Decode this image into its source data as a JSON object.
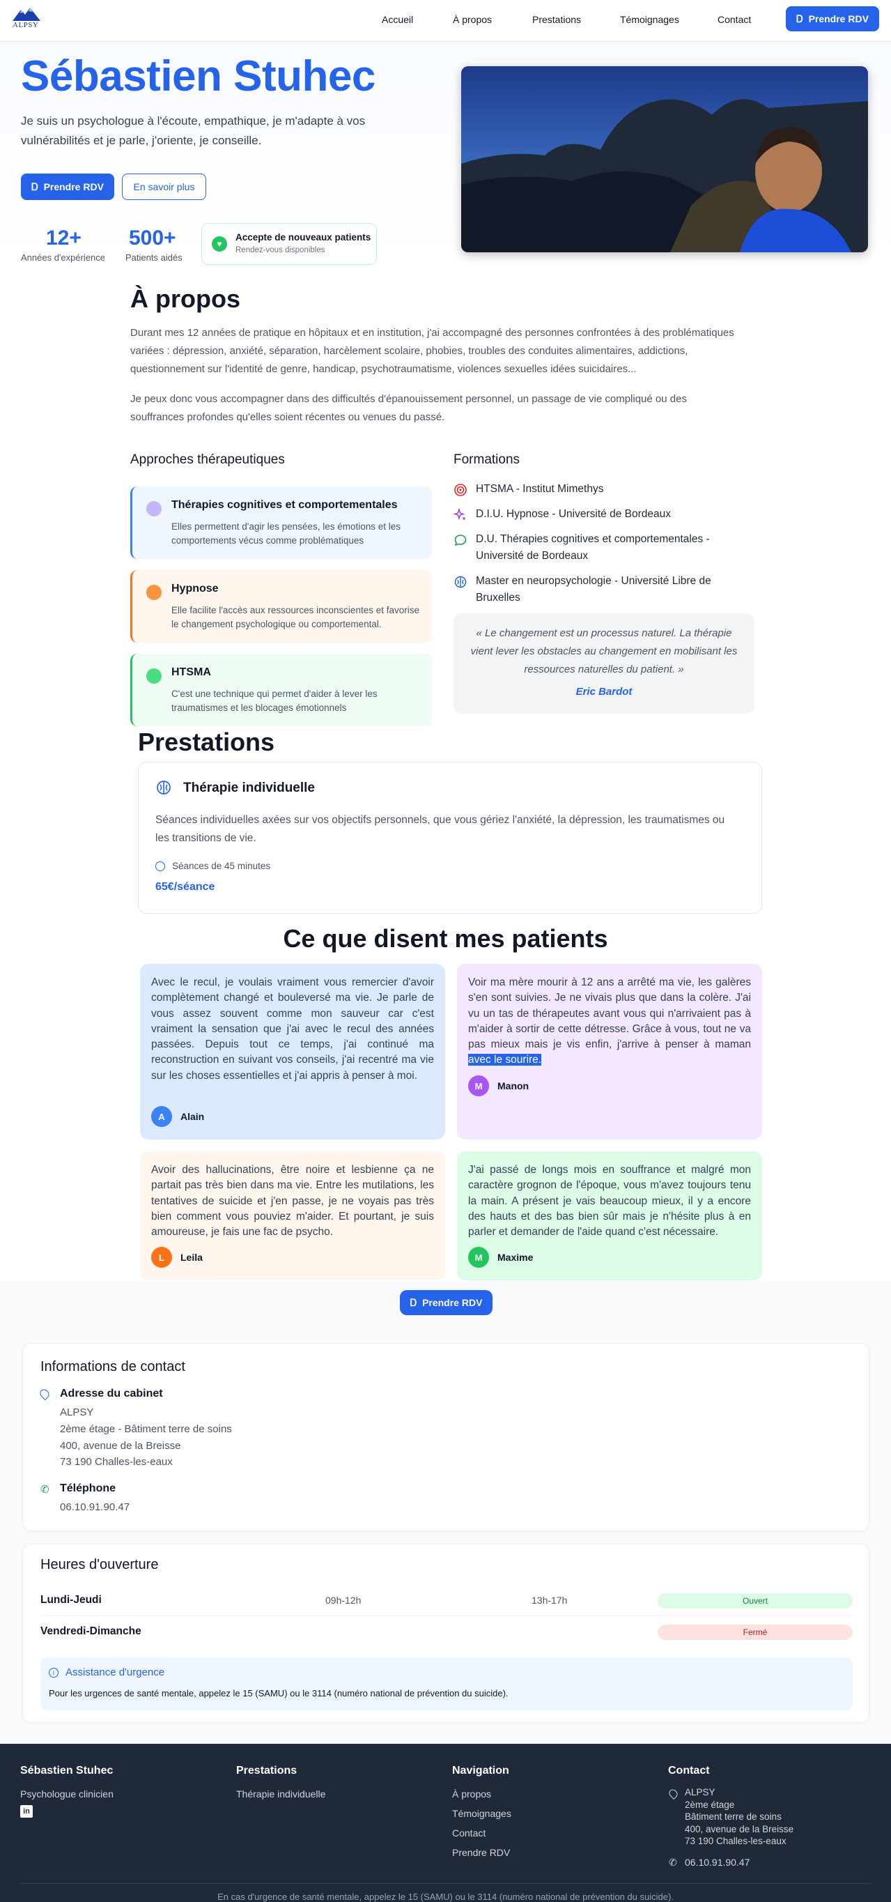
{
  "header": {
    "logo_text": "ALPSY",
    "nav": [
      "Accueil",
      "À propos",
      "Prestations",
      "Témoignages",
      "Contact"
    ],
    "cta": "Prendre RDV"
  },
  "hero": {
    "name": "Sébastien Stuhec",
    "description": "Je suis un psychologue à l'écoute, empathique, je m'adapte à vos vulnérabilités et je parle, j'oriente, je conseille.",
    "primary_button": "Prendre RDV",
    "secondary_button": "En savoir plus",
    "stats": [
      {
        "value": "12+",
        "label": "Années d'expérience"
      },
      {
        "value": "500+",
        "label": "Patients aidés"
      }
    ],
    "availability": {
      "title": "Accepte de nouveaux patients",
      "subtitle": "Rendez-vous disponibles"
    }
  },
  "about": {
    "title": "À propos",
    "paragraph1": "Durant mes 12 années de pratique en hôpitaux et en institution, j'ai accompagné des personnes confrontées à des problématiques variées : dépression, anxiété, séparation, harcèlement scolaire, phobies, troubles des conduites alimentaires, addictions, questionnement sur l'identité de genre, handicap, psychotraumatisme, violences sexuelles idées suicidaires...",
    "paragraph2": "Je peux donc vous accompagner dans des difficultés d'épanouissement personnel, un passage de vie compliqué ou des souffrances profondes qu'elles soient récentes ou venues du passé.",
    "approaches_title": "Approches thérapeutiques",
    "approaches": [
      {
        "title": "Thérapies cognitives et comportementales",
        "description": "Elles permettent d'agir les pensées, les émotions et les comportements vécus comme problématiques",
        "bg": "#eff6ff",
        "border": "#3b82f6",
        "icon": "brain-icon"
      },
      {
        "title": "Hypnose",
        "description": "Elle facilite l'accès aux ressources inconscientes et favorise le changement psychologique ou comportemental.",
        "bg": "#fff7ed",
        "border": "#f97316",
        "icon": "moon-icon"
      },
      {
        "title": "HTSMA",
        "description": "C'est une technique qui permet d'aider à lever les traumatismes et les blocages émotionnels",
        "bg": "#f0fdf4",
        "border": "#22c55e",
        "icon": "sparkle-icon"
      }
    ],
    "formations_title": "Formations",
    "formations": [
      {
        "text": "HTSMA - Institut Mimethys",
        "icon": "target-icon"
      },
      {
        "text": "D.I.U. Hypnose - Université de Bordeaux",
        "icon": "sparkles-icon"
      },
      {
        "text": "D.U. Thérapies cognitives et comportementales - Université de Bordeaux",
        "icon": "chat-icon"
      },
      {
        "text": "Master en neuropsychologie - Université Libre de Bruxelles",
        "icon": "brain-outline-icon"
      }
    ],
    "quote": "« Le changement est un processus naturel. La thérapie vient lever les obstacles au changement en mobilisant les ressources naturelles du patient. »",
    "quote_author": "Eric Bardot"
  },
  "prestations": {
    "title": "Prestations",
    "card_title": "Thérapie individuelle",
    "card_description": "Séances individuelles axées sur vos objectifs personnels, que vous gériez l'anxiété, la dépression, les traumatismes ou les transitions de vie.",
    "duration": "Séances de 45 minutes",
    "price": "65€/séance"
  },
  "testimonials": {
    "title": "Ce que disent mes patients",
    "items": [
      {
        "text": "Avec le recul, je voulais vraiment vous remercier d'avoir complètement changé et bouleversé ma vie. Je parle de vous assez souvent comme mon sauveur car c'est vraiment la sensation que j'ai avec le recul des années passées. Depuis tout ce temps, j'ai continué ma reconstruction en suivant vos conseils, j'ai recentré ma vie sur les choses essentielles et j'ai appris à penser à moi.",
        "initial": "A",
        "name": "Alain",
        "bg": "#dbeafe",
        "avatar": "#3b82f6"
      },
      {
        "text": "Voir ma mère mourir à 12 ans a arrêté ma vie, les galères s'en sont suivies. Je ne vivais plus que dans la colère. J'ai vu un tas de thérapeutes avant vous qui n'arrivaient pas à m'aider à sortir de cette détresse. Grâce à vous, tout ne va pas mieux mais je vis enfin, j'arrive à penser à maman",
        "highlight": "avec le sourire.",
        "initial": "M",
        "name": "Manon",
        "bg": "#f3e8ff",
        "avatar": "#a855f7"
      },
      {
        "text": "Avoir des hallucinations, être noire et lesbienne ça ne partait pas très bien dans ma vie. Entre les mutilations, les tentatives de suicide et j'en passe, je ne voyais pas très bien comment vous pouviez m'aider. Et pourtant, je suis amoureuse, je fais une fac de psycho.",
        "initial": "L",
        "name": "Leila",
        "bg": "#fff7ed",
        "avatar": "#f97316"
      },
      {
        "text": "J'ai passé de longs mois en souffrance et malgré mon caractère grognon de l'époque, vous m'avez toujours tenu la main. A présent je vais beaucoup mieux, il y a encore des hauts et des bas bien sûr mais je n'hésite plus à en parler et demander de l'aide quand c'est nécessaire.",
        "initial": "M",
        "name": "Maxime",
        "bg": "#dcfce7",
        "avatar": "#22c55e"
      }
    ],
    "cta": "Prendre RDV"
  },
  "contact": {
    "title": "Informations de contact",
    "address_label": "Adresse du cabinet",
    "address_lines": [
      "ALPSY",
      "2ème étage - Bâtiment terre de soins",
      "400, avenue de la Breisse",
      "73 190 Challes-les-eaux"
    ],
    "phone_label": "Téléphone",
    "phone": "06.10.91.90.47"
  },
  "hours": {
    "title": "Heures d'ouverture",
    "rows": [
      {
        "days": "Lundi-Jeudi",
        "morning": "09h-12h",
        "afternoon": "13h-17h",
        "status": "Ouvert",
        "status_bg": "#dcfce7",
        "status_color": "#15803d"
      },
      {
        "days": "Vendredi-Dimanche",
        "morning": "",
        "afternoon": "",
        "status": "Fermé",
        "status_bg": "#fee2e2",
        "status_color": "#b91c1c"
      }
    ],
    "emergency_title": "Assistance d'urgence",
    "emergency_text": "Pour les urgences de santé mentale, appelez le 15 (SAMU) ou le 3114 (numéro national de prévention du suicide)."
  },
  "footer": {
    "col1_title": "Sébastien Stuhec",
    "col1_sub": "Psychologue clinicien",
    "col2_title": "Prestations",
    "col2_item": "Thérapie individuelle",
    "col3_title": "Navigation",
    "col3_items": [
      "À propos",
      "Témoignages",
      "Contact",
      "Prendre RDV"
    ],
    "col4_title": "Contact",
    "col4_address": [
      "ALPSY",
      "2ème étage",
      "Bâtiment terre de soins",
      "400, avenue de la Breisse",
      "73 190 Challes-les-eaux"
    ],
    "col4_phone": "06.10.91.90.47",
    "bottom_note": "En cas d'urgence de santé mentale, appelez le 15 (SAMU) ou le 3114 (numéro national de prévention du suicide)."
  },
  "colors": {
    "primary": "#2563eb",
    "footer_bg": "#1f2937"
  }
}
